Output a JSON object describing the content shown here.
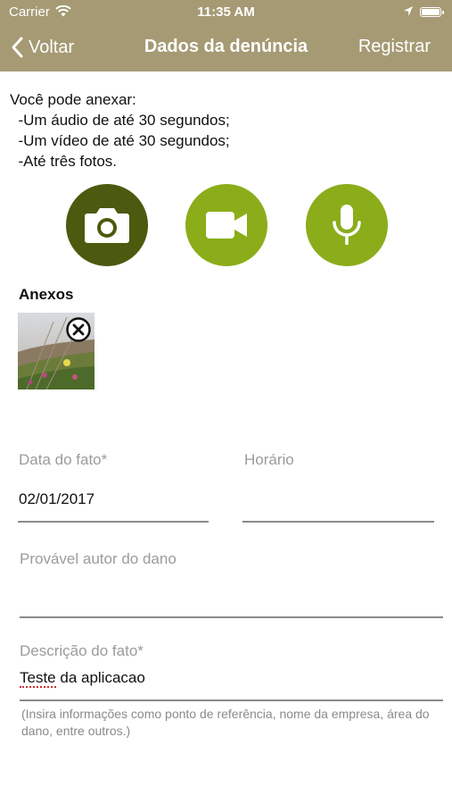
{
  "status_bar": {
    "carrier": "Carrier",
    "time": "11:35 AM",
    "icons": [
      "wifi-icon",
      "location-arrow-icon",
      "battery-icon"
    ]
  },
  "nav": {
    "back_label": "Voltar",
    "title": "Dados da denúncia",
    "action_label": "Registrar"
  },
  "intro": {
    "heading": "Você pode anexar:",
    "items": [
      "-Um áudio de até 30 segundos;",
      "-Um vídeo de até 30 segundos;",
      "-Até três fotos."
    ]
  },
  "media_buttons": [
    {
      "icon": "camera-icon",
      "color": "#4b5a0e"
    },
    {
      "icon": "video-camera-icon",
      "color": "#8bad1a"
    },
    {
      "icon": "microphone-icon",
      "color": "#8bad1a"
    }
  ],
  "attachments": {
    "title": "Anexos",
    "count": 1
  },
  "form": {
    "date_label": "Data do fato*",
    "date_value": "02/01/2017",
    "time_label": "Horário",
    "time_value": "",
    "author_label": "Provável autor do dano",
    "author_value": "",
    "description_label": "Descrição do fato*",
    "description_value_word1": "Teste",
    "description_value_rest": " da aplicacao",
    "help_text": "(Insira informações como ponto de referência, nome da empresa, área do dano, entre outros.)"
  },
  "colors": {
    "nav_background": "#a59a74",
    "camera_button": "#4b5a0e",
    "accent_green": "#8bad1a"
  }
}
